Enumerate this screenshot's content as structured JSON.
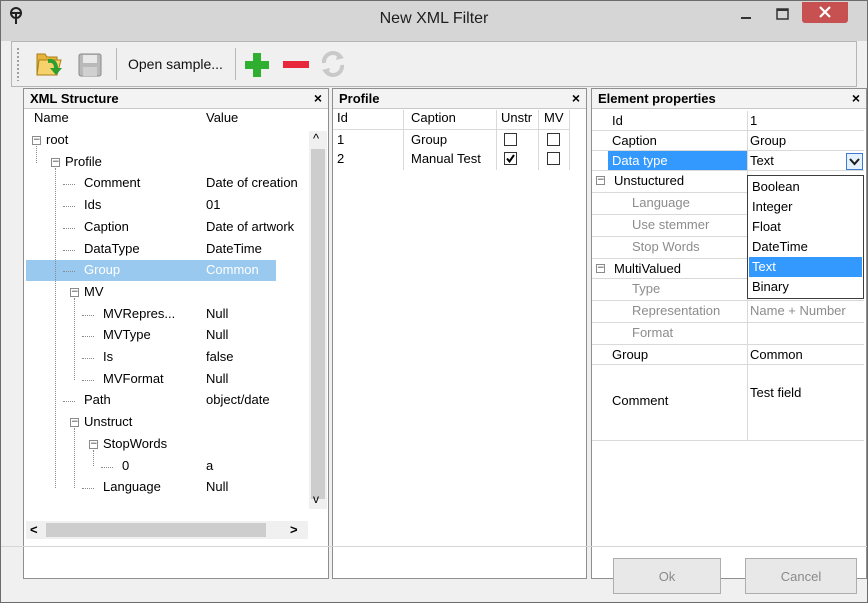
{
  "window": {
    "title": "New XML Filter",
    "buttons": [
      "minimize",
      "maximize",
      "close"
    ]
  },
  "toolbar": {
    "open_folder_icon": "open-folder-icon",
    "save_icon": "save-icon",
    "open_sample_label": "Open sample...",
    "add_icon": "plus-icon",
    "remove_icon": "minus-icon",
    "refresh_icon": "refresh-icon"
  },
  "xml_structure": {
    "title": "XML Structure",
    "close": "×",
    "columns": [
      "Name",
      "Value"
    ],
    "rows": [
      {
        "name": "root",
        "value": "",
        "level": 0,
        "expander": "minus"
      },
      {
        "name": "Profile",
        "value": "",
        "level": 1,
        "expander": "minus"
      },
      {
        "name": "Comment",
        "value": "Date of creation",
        "level": 2
      },
      {
        "name": "Ids",
        "value": "01",
        "level": 2
      },
      {
        "name": "Caption",
        "value": "Date of artwork",
        "level": 2
      },
      {
        "name": "DataType",
        "value": "DateTime",
        "level": 2
      },
      {
        "name": "Group",
        "value": "Common",
        "level": 2,
        "selected": true
      },
      {
        "name": "MV",
        "value": "",
        "level": 2,
        "expander": "minus"
      },
      {
        "name": "MVRepres...",
        "value": "Null",
        "level": 3
      },
      {
        "name": "MVType",
        "value": "Null",
        "level": 3
      },
      {
        "name": "Is",
        "value": "false",
        "level": 3
      },
      {
        "name": "MVFormat",
        "value": "Null",
        "level": 3
      },
      {
        "name": "Path",
        "value": "object/date",
        "level": 2
      },
      {
        "name": "Unstruct",
        "value": "",
        "level": 2,
        "expander": "minus"
      },
      {
        "name": "StopWords",
        "value": "",
        "level": 3,
        "expander": "minus"
      },
      {
        "name": "0",
        "value": "a",
        "level": 4
      },
      {
        "name": "Language",
        "value": "Null",
        "level": 3
      }
    ],
    "scroll_up": "^",
    "scroll_down": "v",
    "scroll_left": "<",
    "scroll_right": ">"
  },
  "profile": {
    "title": "Profile",
    "close": "×",
    "columns": [
      "Id",
      "Caption",
      "Unstr",
      "MV"
    ],
    "rows": [
      {
        "id": "1",
        "caption": "Group",
        "unstr": false,
        "mv": false
      },
      {
        "id": "2",
        "caption": "Manual Test",
        "unstr": true,
        "mv": false
      }
    ]
  },
  "element_properties": {
    "title": "Element properties",
    "close": "×",
    "rows": [
      {
        "label": "Id",
        "value": "1"
      },
      {
        "label": "Caption",
        "value": "Group"
      },
      {
        "label": "Data type",
        "value": "Text",
        "selected": true
      },
      {
        "label": "Unstuctured",
        "value": "",
        "category": true
      },
      {
        "label": "Language",
        "value": "",
        "disabled": true
      },
      {
        "label": "Use stemmer",
        "value": "",
        "disabled": true
      },
      {
        "label": "Stop Words",
        "value": "",
        "disabled": true
      },
      {
        "label": "MultiValued",
        "value": "",
        "category": true
      },
      {
        "label": "Type",
        "value": "",
        "disabled": true
      },
      {
        "label": "Representation",
        "value": "Name + Number",
        "disabled": true
      },
      {
        "label": "Format",
        "value": "",
        "disabled": true
      },
      {
        "label": "Group",
        "value": "Common"
      },
      {
        "label": "Comment",
        "value": "Test field"
      }
    ],
    "collapse_glyph": "−",
    "dropdown_options": [
      "Boolean",
      "Integer",
      "Float",
      "DateTime",
      "Text",
      "Binary"
    ],
    "dropdown_selected": "Text"
  },
  "footer": {
    "ok_label": "Ok",
    "cancel_label": "Cancel"
  },
  "colors": {
    "selection": "#99c9ef",
    "list_selection": "#3399ff",
    "close_button": "#c75050"
  }
}
